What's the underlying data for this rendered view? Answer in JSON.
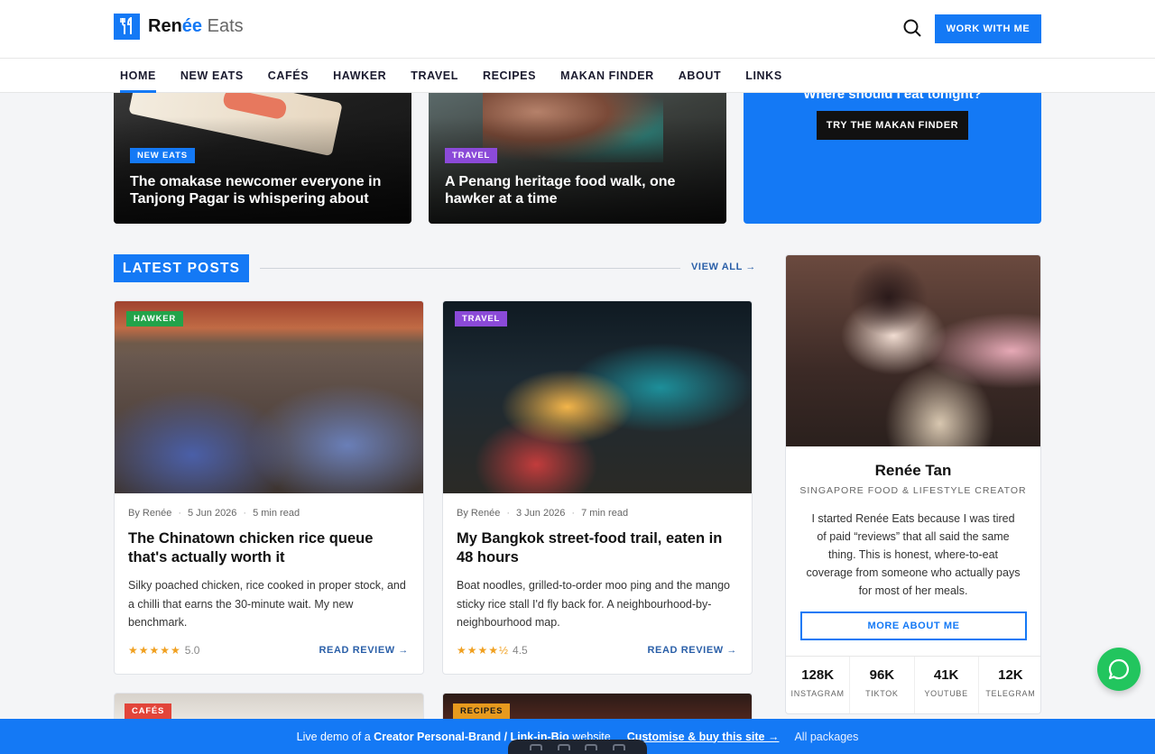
{
  "header": {
    "logo_bold": "Ren",
    "logo_accent": "ée",
    "logo_light": " Eats",
    "cta": "WORK WITH ME"
  },
  "nav": [
    "HOME",
    "NEW EATS",
    "CAFÉS",
    "HAWKER",
    "TRAVEL",
    "RECIPES",
    "MAKAN FINDER",
    "ABOUT",
    "LINKS"
  ],
  "featured": [
    {
      "tag": "NEW EATS",
      "title": "The omakase newcomer everyone in Tanjong Pagar is whispering about"
    },
    {
      "tag": "TRAVEL",
      "title": "A Penang heritage food walk, one hawker at a time"
    }
  ],
  "makan": {
    "question": "Where should I eat tonight?",
    "button": "TRY THE MAKAN FINDER"
  },
  "latest": {
    "heading": "LATEST POSTS",
    "view_all": "VIEW ALL →"
  },
  "posts": [
    {
      "tag": "HAWKER",
      "author": "By Renée",
      "date": "5 Jun 2026",
      "read_time": "5 min read",
      "title": "The Chinatown chicken rice queue that's actually worth it",
      "excerpt": "Silky poached chicken, rice cooked in proper stock, and a chilli that earns the 30-minute wait. My new benchmark.",
      "stars": "★★★★★",
      "score": "5.0",
      "cta": "READ REVIEW →"
    },
    {
      "tag": "TRAVEL",
      "author": "By Renée",
      "date": "3 Jun 2026",
      "read_time": "7 min read",
      "title": "My Bangkok street-food trail, eaten in 48 hours",
      "excerpt": "Boat noodles, grilled-to-order moo ping and the mango sticky rice stall I'd fly back for. A neighbourhood-by-neighbourhood map.",
      "stars": "★★★★½",
      "score": "4.5",
      "cta": "READ REVIEW →"
    }
  ],
  "more_posts": [
    {
      "tag": "CAFÉS"
    },
    {
      "tag": "RECIPES"
    }
  ],
  "profile": {
    "name": "Renée Tan",
    "role": "SINGAPORE FOOD & LIFESTYLE CREATOR",
    "bio": "I started Renée Eats because I was tired of paid “reviews” that all said the same thing. This is honest, where-to-eat coverage from someone who actually pays for most of her meals.",
    "button": "MORE ABOUT ME",
    "stats": [
      {
        "value": "128K",
        "label": "INSTAGRAM"
      },
      {
        "value": "96K",
        "label": "TIKTOK"
      },
      {
        "value": "41K",
        "label": "YOUTUBE"
      },
      {
        "value": "12K",
        "label": "TELEGRAM"
      }
    ]
  },
  "demo_bar": {
    "prefix": "Live demo of a ",
    "bold": "Creator Personal-Brand / Link-in-Bio",
    "suffix": " website",
    "link": "Customise & buy this site →",
    "all": "All packages"
  },
  "colors": {
    "accent": "#1479f5",
    "hawker": "#22a34a",
    "travel": "#8b4ad8",
    "cafes": "#e2453a",
    "recipes": "#e79a1e",
    "chat": "#22c55e"
  }
}
